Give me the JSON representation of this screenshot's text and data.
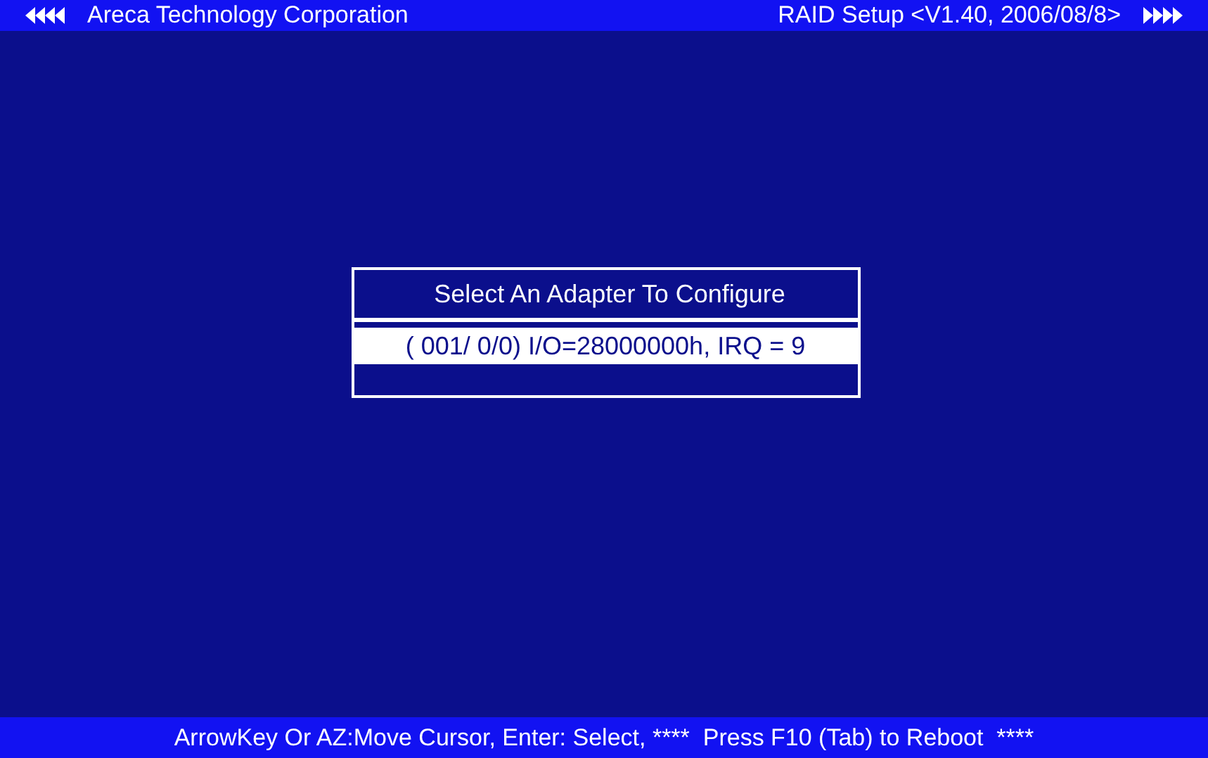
{
  "header": {
    "company": "Areca Technology Corporation",
    "title": "RAID Setup <V1.40, 2006/08/8>"
  },
  "dialog": {
    "title": "Select An Adapter To Configure",
    "adapters": [
      {
        "label": "( 001/ 0/0) I/O=28000000h, IRQ = 9",
        "selected": true
      }
    ]
  },
  "status_bar": {
    "hint": "ArrowKey Or AZ:Move Cursor, Enter: Select, ****  Press F10 (Tab) to Reboot  ****"
  }
}
